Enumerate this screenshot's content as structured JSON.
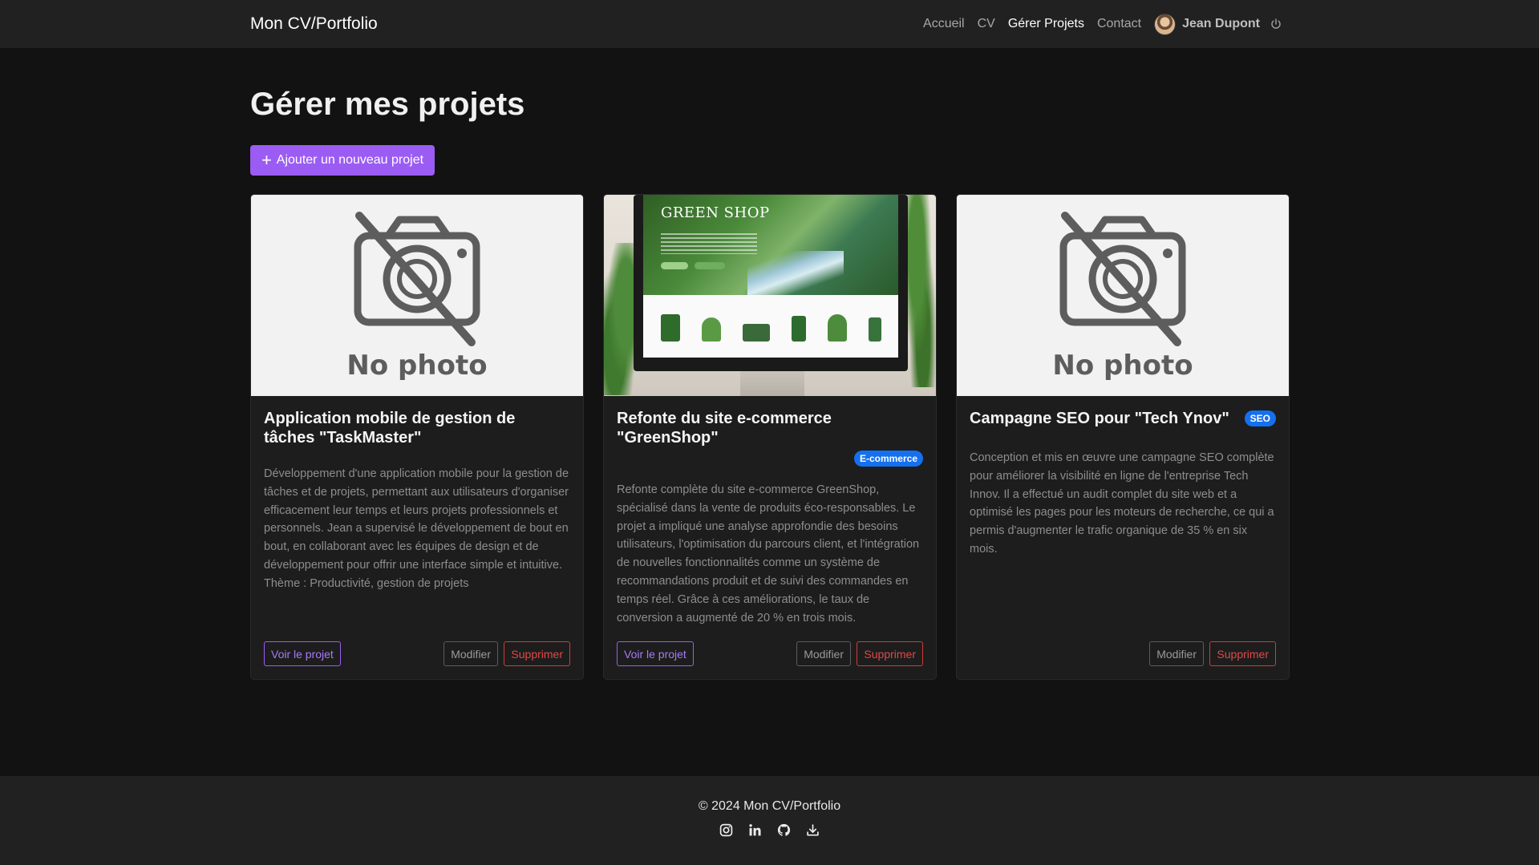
{
  "navbar": {
    "brand": "Mon CV/Portfolio",
    "links": [
      "Accueil",
      "CV",
      "Gérer Projets",
      "Contact"
    ],
    "active_link": "Gérer Projets",
    "user_name": "Jean Dupont"
  },
  "main": {
    "page_title": "Gérer mes projets",
    "add_button_label": "Ajouter un nouveau projet",
    "no_photo_text": "No photo",
    "projects": [
      {
        "title": "Application mobile de gestion de tâches \"TaskMaster\"",
        "badge": "",
        "image": "no-photo",
        "description": "Développement d'une application mobile pour la gestion de tâches et de projets, permettant aux utilisateurs d'organiser efficacement leur temps et leurs projets professionnels et personnels. Jean a supervisé le développement de bout en bout, en collaborant avec les équipes de design et de développement pour offrir une interface simple et intuitive.",
        "theme": "Thème : Productivité, gestion de projets",
        "view_label": "Voir le projet",
        "edit_label": "Modifier",
        "delete_label": "Supprimer"
      },
      {
        "title": "Refonte du site e-commerce \"GreenShop\"",
        "badge": "E-commerce",
        "image": "greenshop-screenshot",
        "image_title": "GREEN SHOP",
        "description": "Refonte complète du site e-commerce GreenShop, spécialisé dans la vente de produits éco-responsables. Le projet a impliqué une analyse approfondie des besoins utilisateurs, l'optimisation du parcours client, et l'intégration de nouvelles fonctionnalités comme un système de recommandations produit et de suivi des commandes en temps réel. Grâce à ces améliorations, le taux de conversion a augmenté de 20 % en trois mois.",
        "theme": "",
        "view_label": "Voir le projet",
        "edit_label": "Modifier",
        "delete_label": "Supprimer"
      },
      {
        "title": "Campagne SEO pour \"Tech Ynov\"",
        "badge": "SEO",
        "image": "no-photo",
        "description": "Conception et mis en œuvre une campagne SEO complète pour améliorer la visibilité en ligne de l'entreprise Tech Innov. Il a effectué un audit complet du site web et a optimisé les pages pour les moteurs de recherche, ce qui a permis d'augmenter le trafic organique de 35 % en six mois.",
        "theme": "",
        "view_label": "",
        "edit_label": "Modifier",
        "delete_label": "Supprimer"
      }
    ]
  },
  "footer": {
    "copyright": "© 2024 Mon CV/Portfolio",
    "socials": [
      "instagram-icon",
      "linkedin-icon",
      "github-icon",
      "download-icon"
    ]
  },
  "colors": {
    "accent": "#9b5cf4",
    "danger": "#e04848",
    "badge": "#1570ef",
    "background": "#121212",
    "navbar": "#212121"
  }
}
